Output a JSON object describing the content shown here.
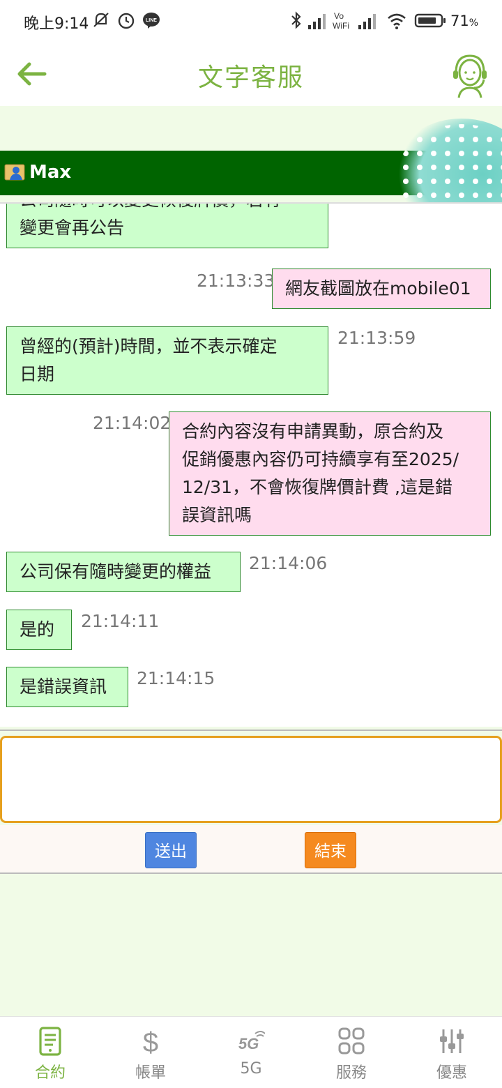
{
  "status_bar": {
    "time": "晚上9:14",
    "battery_percent": "71",
    "battery_unit": "%"
  },
  "header": {
    "title": "文字客服"
  },
  "agent_bar": {
    "name": "Max"
  },
  "messages": [
    {
      "from": "agent",
      "text_line1": "公司隨時可以變更恢復牌價，若有",
      "text_line2": "變更會再公告"
    },
    {
      "from": "user",
      "time": "21:13:33",
      "text": "網友截圖放在mobile01"
    },
    {
      "from": "agent",
      "time": "21:13:59",
      "text_line1": "曾經的(預計)時間，並不表示確定",
      "text_line2": "日期"
    },
    {
      "from": "user",
      "time": "21:14:02",
      "text_line1": "合約內容沒有申請異動，原合約及",
      "text_line2": "促銷優惠內容仍可持續享有至2025/",
      "text_line3": "12/31，不會恢復牌價計費 ,這是錯",
      "text_line4": "誤資訊嗎"
    },
    {
      "from": "agent",
      "time": "21:14:06",
      "text": "公司保有隨時變更的權益"
    },
    {
      "from": "agent",
      "time": "21:14:11",
      "text": "是的"
    },
    {
      "from": "agent",
      "time": "21:14:15",
      "text": "是錯誤資訊"
    }
  ],
  "input": {
    "value": "",
    "placeholder": ""
  },
  "actions": {
    "send_label": "送出",
    "end_label": "結束"
  },
  "bottom_nav": {
    "items": [
      {
        "label": "合約",
        "icon": "contract-icon",
        "active": true
      },
      {
        "label": "帳單",
        "icon": "dollar-icon",
        "active": false
      },
      {
        "label": "5G",
        "icon": "5g-icon",
        "active": false
      },
      {
        "label": "服務",
        "icon": "grid-icon",
        "active": false
      },
      {
        "label": "優惠",
        "icon": "sliders-icon",
        "active": false
      }
    ]
  },
  "colors": {
    "brand_green": "#7cb342",
    "agent_bar": "#006400",
    "agent_bubble": "#ccffcc",
    "user_bubble": "#ffdcee",
    "send_button": "#4f86e0",
    "end_button": "#f58a1f"
  }
}
